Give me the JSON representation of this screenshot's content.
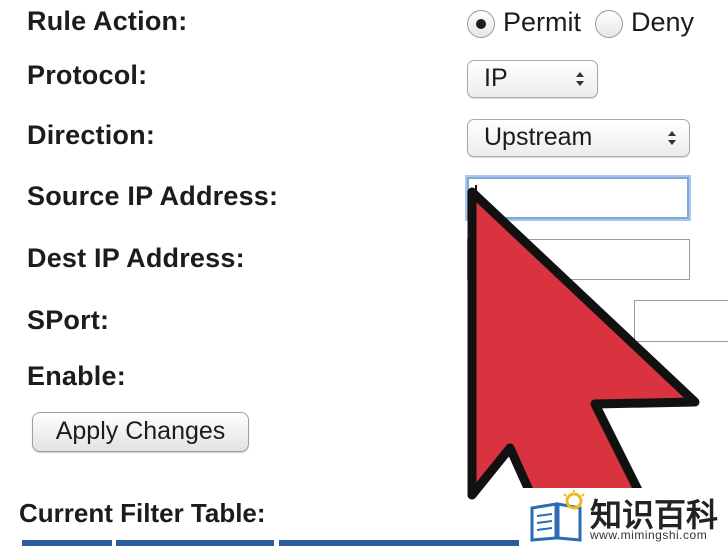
{
  "form": {
    "rule_action": {
      "label": "Rule Action:",
      "options": [
        "Permit",
        "Deny"
      ],
      "selected": "Permit"
    },
    "protocol": {
      "label": "Protocol:",
      "value": "IP"
    },
    "direction": {
      "label": "Direction:",
      "value": "Upstream"
    },
    "source_ip": {
      "label": "Source IP Address:",
      "value": ""
    },
    "dest_ip": {
      "label": "Dest IP Address:",
      "value": ""
    },
    "sport": {
      "label": "SPort:",
      "value": ""
    },
    "enable": {
      "label": "Enable:"
    },
    "apply_button": "Apply Changes"
  },
  "filter_table": {
    "title": "Current Filter Table:"
  },
  "watermark": {
    "name": "知识百科",
    "url": "www.mimingshi.com"
  },
  "colors": {
    "cursor_fill": "#d9333f",
    "table_header": "#2b5c9c",
    "focus_ring": "#a9c7ea",
    "logo_blue": "#2a6db5",
    "logo_yellow": "#f2b722"
  },
  "icons": [
    "mouse-pointer-icon",
    "book-lightbulb-icon",
    "select-arrows-icon"
  ]
}
